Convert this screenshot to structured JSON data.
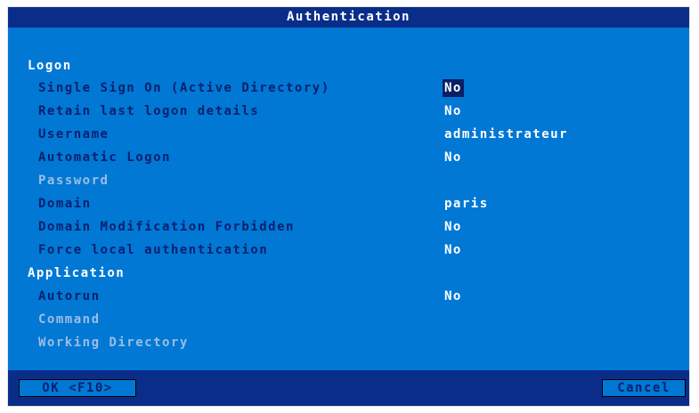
{
  "window": {
    "title": "Authentication"
  },
  "sections": {
    "logon": "Logon",
    "application": "Application"
  },
  "fields": {
    "sso": {
      "label": "Single Sign On (Active Directory)",
      "value": "No"
    },
    "retain": {
      "label": "Retain last logon details",
      "value": "No"
    },
    "username": {
      "label": "Username",
      "value": "administrateur"
    },
    "autologon": {
      "label": "Automatic Logon",
      "value": "No"
    },
    "password": {
      "label": "Password",
      "value": ""
    },
    "domain": {
      "label": "Domain",
      "value": "paris"
    },
    "domain_mod": {
      "label": "Domain Modification Forbidden",
      "value": "No"
    },
    "force_local": {
      "label": "Force local authentication",
      "value": "No"
    },
    "autorun": {
      "label": "Autorun",
      "value": "No"
    },
    "command": {
      "label": "Command",
      "value": ""
    },
    "workdir": {
      "label": "Working Directory",
      "value": ""
    }
  },
  "buttons": {
    "ok": "OK <F10>",
    "cancel": "Cancel"
  },
  "colors": {
    "background": "#0078d4",
    "titlebar": "#0a2d8a",
    "label": "#0a1f6e",
    "disabled_label": "#9dbde4",
    "value": "#ffffff",
    "focus": "#0a2066"
  }
}
